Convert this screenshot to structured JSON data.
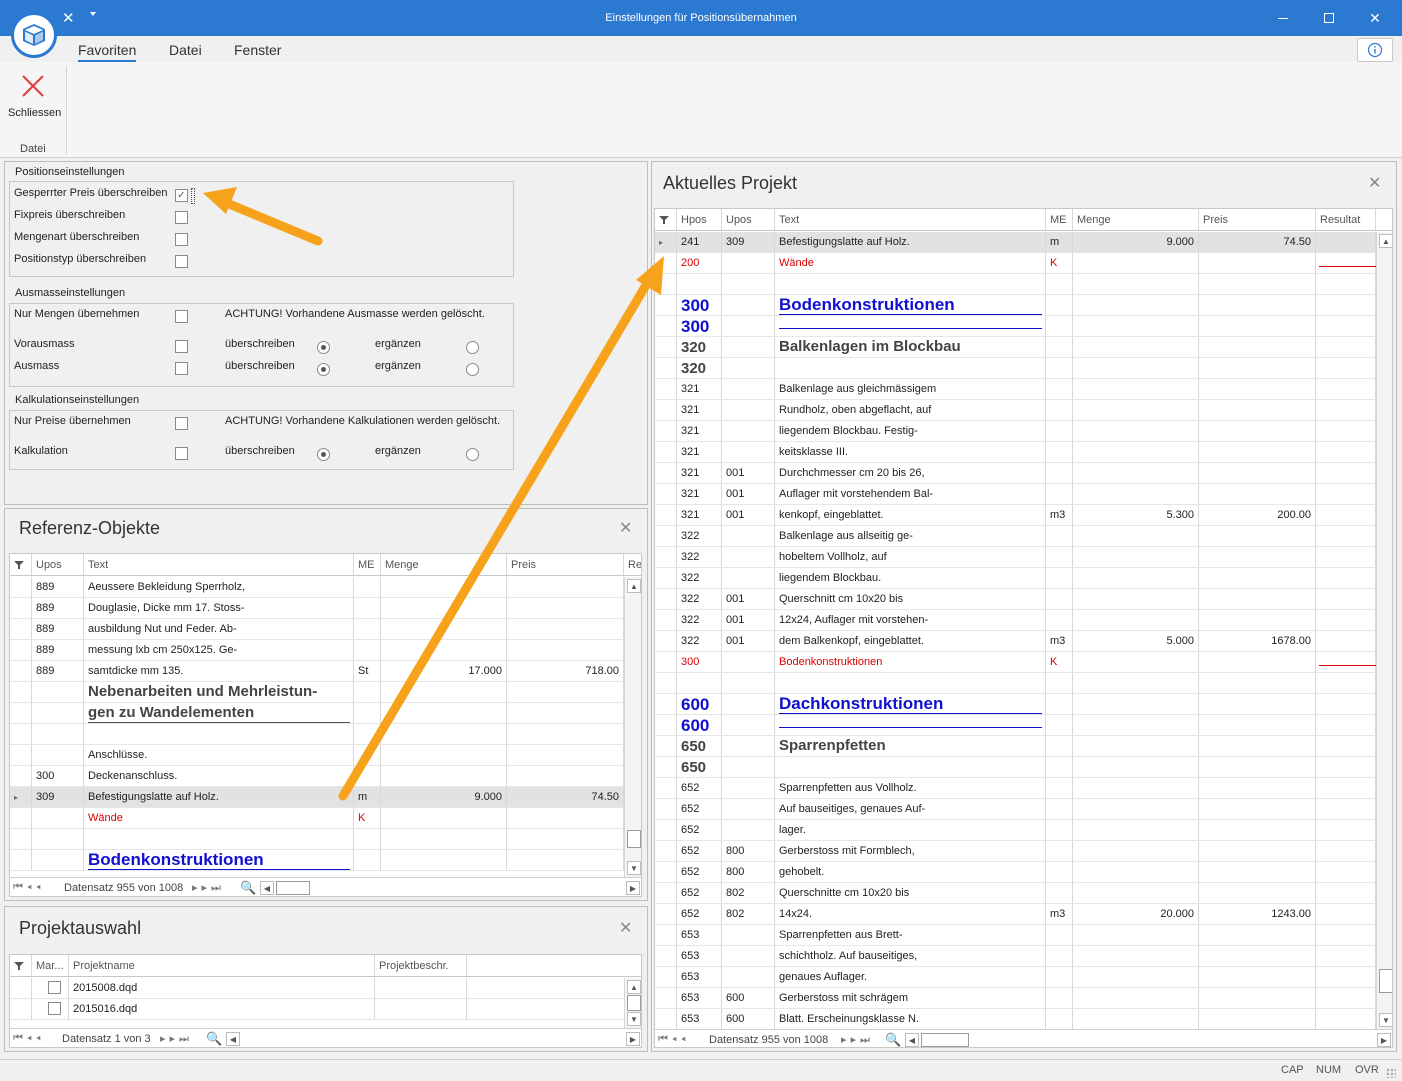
{
  "window": {
    "title": "Einstellungen für Positionsübernahmen",
    "accent": "#2b79d0"
  },
  "menu": {
    "favoriten": "Favoriten",
    "datei": "Datei",
    "fenster": "Fenster"
  },
  "ribbon": {
    "close_label": "Schliessen",
    "group_label": "Datei"
  },
  "settings": {
    "pos_title": "Positionseinstellungen",
    "pos_rows": [
      "Gesperrter Preis überschreiben",
      "Fixpreis überschreiben",
      "Mengenart überschreiben",
      "Positionstyp überschreiben"
    ],
    "ausmass_title": "Ausmasseinstellungen",
    "nur_mengen": "Nur Mengen übernehmen",
    "warn_ausmass": "ACHTUNG! Vorhandene Ausmasse werden gelöscht.",
    "vorausmass": "Vorausmass",
    "ausmass": "Ausmass",
    "ueberschreiben": "überschreiben",
    "ergaenzen": "ergänzen",
    "kalk_title": "Kalkulationseinstellungen",
    "nur_preise": "Nur Preise übernehmen",
    "warn_kalk": "ACHTUNG! Vorhandene Kalkulationen werden gelöscht.",
    "kalkulation": "Kalkulation"
  },
  "referenz": {
    "title": "Referenz-Objekte",
    "columns": [
      "Upos",
      "Text",
      "ME",
      "Menge",
      "Preis",
      "Res"
    ],
    "rows": [
      {
        "upos": "889",
        "text": "Aeussere Bekleidung Sperrholz,",
        "me": "",
        "menge": "",
        "preis": ""
      },
      {
        "upos": "889",
        "text": "Douglasie, Dicke mm 17. Stoss-",
        "me": "",
        "menge": "",
        "preis": ""
      },
      {
        "upos": "889",
        "text": "ausbildung Nut und Feder. Ab-",
        "me": "",
        "menge": "",
        "preis": ""
      },
      {
        "upos": "889",
        "text": "messung lxb cm 250x125. Ge-",
        "me": "",
        "menge": "",
        "preis": ""
      },
      {
        "upos": "889",
        "text": "samtdicke mm 135.",
        "me": "St",
        "menge": "17.000",
        "preis": "718.00"
      },
      {
        "upos": "",
        "text": "Nebenarbeiten und Mehrleistun-",
        "me": "",
        "menge": "",
        "preis": "",
        "style": "gray"
      },
      {
        "upos": "",
        "text": "gen zu Wandelementen",
        "me": "",
        "menge": "",
        "preis": "",
        "style": "gray-ul"
      },
      {
        "upos": "",
        "text": "",
        "me": "",
        "menge": "",
        "preis": ""
      },
      {
        "upos": "",
        "text": "Anschlüsse.",
        "me": "",
        "menge": "",
        "preis": ""
      },
      {
        "upos": "300",
        "text": "Deckenanschluss.",
        "me": "",
        "menge": "",
        "preis": ""
      },
      {
        "upos": "309",
        "text": "Befestigungslatte auf Holz.",
        "me": "m",
        "menge": "9.000",
        "preis": "74.50",
        "selected": true
      },
      {
        "upos": "",
        "text": "Wände",
        "me": "K",
        "menge": "",
        "preis": "",
        "style": "red"
      },
      {
        "upos": "",
        "text": "",
        "me": "",
        "menge": "",
        "preis": ""
      },
      {
        "upos": "",
        "text": "Bodenkonstruktionen",
        "me": "",
        "menge": "",
        "preis": "",
        "style": "blue"
      }
    ],
    "nav_text": "Datensatz 955 von 1008"
  },
  "projektauswahl": {
    "title": "Projektauswahl",
    "columns": [
      "Mar...",
      "Projektname",
      "Projektbeschr."
    ],
    "rows": [
      {
        "name": "2015008.dqd",
        "checked": false
      },
      {
        "name": "2015016.dqd",
        "checked": false
      }
    ],
    "nav_text": "Datensatz 1 von 3"
  },
  "aktuell": {
    "title": "Aktuelles Projekt",
    "columns": [
      "Hpos",
      "Upos",
      "Text",
      "ME",
      "Menge",
      "Preis",
      "Resultat"
    ],
    "rows": [
      {
        "hpos": "241",
        "upos": "309",
        "text": "Befestigungslatte auf Holz.",
        "me": "m",
        "menge": "9.000",
        "preis": "74.50",
        "selected": true
      },
      {
        "hpos": "200",
        "upos": "",
        "text": "Wände",
        "me": "K",
        "menge": "",
        "preis": "",
        "style": "red"
      },
      {
        "hpos": "",
        "upos": "",
        "text": "",
        "me": "",
        "menge": "",
        "preis": ""
      },
      {
        "hpos": "300",
        "upos": "",
        "text": "Bodenkonstruktionen",
        "me": "",
        "menge": "",
        "preis": "",
        "style": "blue"
      },
      {
        "hpos": "300",
        "upos": "",
        "text": "",
        "me": "",
        "menge": "",
        "preis": "",
        "style": "blue"
      },
      {
        "hpos": "320",
        "upos": "",
        "text": "Balkenlagen im Blockbau",
        "me": "",
        "menge": "",
        "preis": "",
        "style": "gray"
      },
      {
        "hpos": "320",
        "upos": "",
        "text": "",
        "me": "",
        "menge": "",
        "preis": "",
        "style": "gray"
      },
      {
        "hpos": "321",
        "upos": "",
        "text": "Balkenlage aus gleichmässigem",
        "me": "",
        "menge": "",
        "preis": ""
      },
      {
        "hpos": "321",
        "upos": "",
        "text": "Rundholz, oben abgeflacht, auf",
        "me": "",
        "menge": "",
        "preis": ""
      },
      {
        "hpos": "321",
        "upos": "",
        "text": "liegendem Blockbau. Festig-",
        "me": "",
        "menge": "",
        "preis": ""
      },
      {
        "hpos": "321",
        "upos": "",
        "text": "keitsklasse III.",
        "me": "",
        "menge": "",
        "preis": ""
      },
      {
        "hpos": "321",
        "upos": "001",
        "text": "Durchchmesser cm 20 bis 26,",
        "me": "",
        "menge": "",
        "preis": ""
      },
      {
        "hpos": "321",
        "upos": "001",
        "text": "Auflager mit vorstehendem Bal-",
        "me": "",
        "menge": "",
        "preis": ""
      },
      {
        "hpos": "321",
        "upos": "001",
        "text": "kenkopf, eingeblattet.",
        "me": "m3",
        "menge": "5.300",
        "preis": "200.00"
      },
      {
        "hpos": "322",
        "upos": "",
        "text": "Balkenlage aus allseitig ge-",
        "me": "",
        "menge": "",
        "preis": ""
      },
      {
        "hpos": "322",
        "upos": "",
        "text": "hobeltem Vollholz, auf",
        "me": "",
        "menge": "",
        "preis": ""
      },
      {
        "hpos": "322",
        "upos": "",
        "text": "liegendem Blockbau.",
        "me": "",
        "menge": "",
        "preis": ""
      },
      {
        "hpos": "322",
        "upos": "001",
        "text": "Querschnitt cm 10x20 bis",
        "me": "",
        "menge": "",
        "preis": ""
      },
      {
        "hpos": "322",
        "upos": "001",
        "text": "12x24, Auflager mit vorstehen-",
        "me": "",
        "menge": "",
        "preis": ""
      },
      {
        "hpos": "322",
        "upos": "001",
        "text": "dem Balkenkopf, eingeblattet.",
        "me": "m3",
        "menge": "5.000",
        "preis": "1678.00"
      },
      {
        "hpos": "300",
        "upos": "",
        "text": "Bodenkonstruktionen",
        "me": "K",
        "menge": "",
        "preis": "",
        "style": "red"
      },
      {
        "hpos": "",
        "upos": "",
        "text": "",
        "me": "",
        "menge": "",
        "preis": ""
      },
      {
        "hpos": "600",
        "upos": "",
        "text": "Dachkonstruktionen",
        "me": "",
        "menge": "",
        "preis": "",
        "style": "blue"
      },
      {
        "hpos": "600",
        "upos": "",
        "text": "",
        "me": "",
        "menge": "",
        "preis": "",
        "style": "blue"
      },
      {
        "hpos": "650",
        "upos": "",
        "text": "Sparrenpfetten",
        "me": "",
        "menge": "",
        "preis": "",
        "style": "gray"
      },
      {
        "hpos": "650",
        "upos": "",
        "text": "",
        "me": "",
        "menge": "",
        "preis": "",
        "style": "gray"
      },
      {
        "hpos": "652",
        "upos": "",
        "text": "Sparrenpfetten aus Vollholz.",
        "me": "",
        "menge": "",
        "preis": ""
      },
      {
        "hpos": "652",
        "upos": "",
        "text": "Auf bauseitiges, genaues Auf-",
        "me": "",
        "menge": "",
        "preis": ""
      },
      {
        "hpos": "652",
        "upos": "",
        "text": "lager.",
        "me": "",
        "menge": "",
        "preis": ""
      },
      {
        "hpos": "652",
        "upos": "800",
        "text": "Gerberstoss mit Formblech,",
        "me": "",
        "menge": "",
        "preis": ""
      },
      {
        "hpos": "652",
        "upos": "800",
        "text": "gehobelt.",
        "me": "",
        "menge": "",
        "preis": ""
      },
      {
        "hpos": "652",
        "upos": "802",
        "text": "Querschnitte cm 10x20 bis",
        "me": "",
        "menge": "",
        "preis": ""
      },
      {
        "hpos": "652",
        "upos": "802",
        "text": "14x24.",
        "me": "m3",
        "menge": "20.000",
        "preis": "1243.00"
      },
      {
        "hpos": "653",
        "upos": "",
        "text": "Sparrenpfetten aus Brett-",
        "me": "",
        "menge": "",
        "preis": ""
      },
      {
        "hpos": "653",
        "upos": "",
        "text": "schichtholz. Auf bauseitiges,",
        "me": "",
        "menge": "",
        "preis": ""
      },
      {
        "hpos": "653",
        "upos": "",
        "text": "genaues Auflager.",
        "me": "",
        "menge": "",
        "preis": ""
      },
      {
        "hpos": "653",
        "upos": "600",
        "text": "Gerberstoss mit schrägem",
        "me": "",
        "menge": "",
        "preis": ""
      },
      {
        "hpos": "653",
        "upos": "600",
        "text": "Blatt. Erscheinungsklasse N.",
        "me": "",
        "menge": "",
        "preis": ""
      }
    ],
    "nav_text": "Datensatz 955 von 1008"
  },
  "status": {
    "cap": "CAP",
    "num": "NUM",
    "ovr": "OVR"
  },
  "colors": {
    "annotation_arrow": "#f7a21b",
    "red_text": "#dd0000",
    "blue_heading": "#1010d0"
  }
}
